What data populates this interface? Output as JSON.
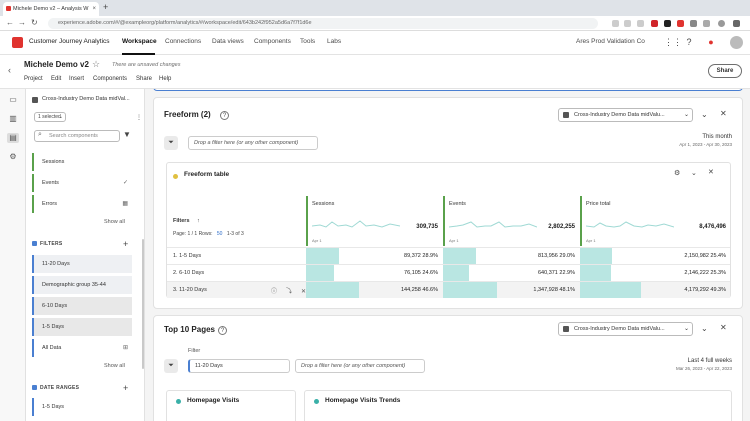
{
  "browser": {
    "tab_title": "Michele Demo v2 – Analysis W",
    "url": "experience.adobe.com/#/@exampleorg/platform/analytics/#/workspace/edit/643b242f952a5d6a7f7f1d6e",
    "new_tab": "+"
  },
  "app": {
    "name": "Customer Journey Analytics",
    "nav": [
      "Workspace",
      "Connections",
      "Data views",
      "Components",
      "Tools",
      "Labs"
    ],
    "org": "Ares Prod Validation Co"
  },
  "project": {
    "title": "Michele Demo v2",
    "unsaved": "There are unsaved changes",
    "menu": [
      "Project",
      "Edit",
      "Insert",
      "Components",
      "Share",
      "Help"
    ],
    "share_label": "Share"
  },
  "panel": {
    "dataset": "Cross-Industry Demo Data midVal...",
    "selected": "1 selected",
    "search_placeholder": "Search components",
    "metrics": [
      {
        "label": "Sessions",
        "mark": ""
      },
      {
        "label": "Events",
        "mark": "✓"
      },
      {
        "label": "Errors",
        "mark": "▦"
      }
    ],
    "show_all": "Show all",
    "filters_title": "FILTERS",
    "filters": [
      {
        "label": "11-20 Days",
        "mark": ""
      },
      {
        "label": "Demographic group 35-44",
        "mark": ""
      },
      {
        "label": "6-10 Days",
        "mark": ""
      },
      {
        "label": "1-5 Days",
        "mark": ""
      },
      {
        "label": "All Data",
        "mark": "⊞"
      }
    ],
    "date_ranges_title": "DATE RANGES",
    "date_ranges": [
      {
        "label": "1-5 Days"
      }
    ]
  },
  "freeform": {
    "title": "Freeform (2)",
    "dataset": "Cross-Industry Demo Data midValu...",
    "filter_placeholder": "Drop a filter here (or any other component)",
    "date_label": "This month",
    "date_range": "Apr 1, 2023 - Apr 30, 2023",
    "table_title": "Freeform table",
    "filters_header": "Filters",
    "sort_icon": "↑",
    "page_prefix": "Page: 1 / 1 Rows:",
    "rows_per_page": "50",
    "range": "1-3 of 3",
    "columns": [
      {
        "name": "Sessions",
        "total": "309,735",
        "apr": "Apr 1"
      },
      {
        "name": "Events",
        "total": "2,802,255",
        "apr": "Apr 1"
      },
      {
        "name": "Price total",
        "total": "8,476,496",
        "apr": "Apr 1"
      }
    ],
    "rows": [
      {
        "label": "1.  1-5 Days",
        "cells": [
          {
            "v": "89,372  28.9%",
            "pct": 28.9
          },
          {
            "v": "813,956  29.0%",
            "pct": 29.0
          },
          {
            "v": "2,150,982  25.4%",
            "pct": 25.4
          }
        ]
      },
      {
        "label": "2.  6-10 Days",
        "cells": [
          {
            "v": "76,105  24.6%",
            "pct": 24.6
          },
          {
            "v": "640,371  22.9%",
            "pct": 22.9
          },
          {
            "v": "2,146,222  25.3%",
            "pct": 25.3
          }
        ]
      },
      {
        "label": "3.  11-20 Days",
        "cells": [
          {
            "v": "144,258  46.6%",
            "pct": 46.6
          },
          {
            "v": "1,347,928  48.1%",
            "pct": 48.1
          },
          {
            "v": "4,179,292  49.3%",
            "pct": 49.3
          }
        ]
      }
    ]
  },
  "top10": {
    "title": "Top 10 Pages",
    "dataset": "Cross-Industry Demo Data midValu...",
    "filter_label": "Filter",
    "filter_value": "11-20 Days",
    "filter_placeholder": "Drop a filter here (or any other component)",
    "date_label": "Last 4 full weeks",
    "date_range": "Mar 26, 2023 - Apr 22, 2023",
    "sub1": "Homepage Visits",
    "sub2": "Homepage Visits Trends"
  },
  "colors": {
    "brand": "#e0332f",
    "metric": "#5aa14b",
    "segment": "#4a7fd1",
    "bar": "#b9e6e2"
  }
}
